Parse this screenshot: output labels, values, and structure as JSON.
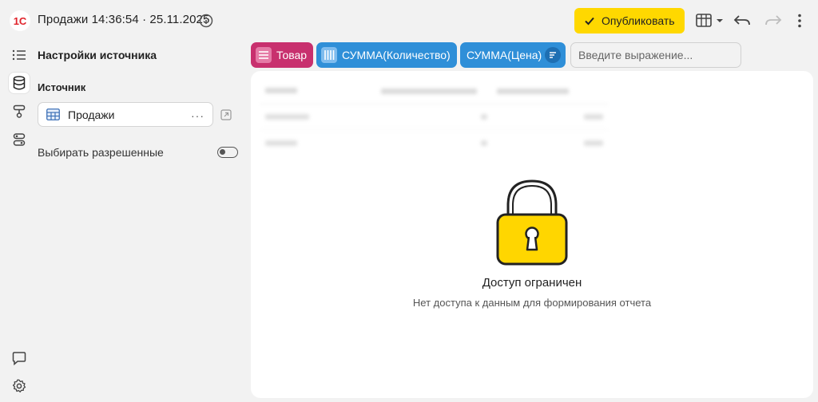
{
  "header": {
    "logo_text": "1С",
    "title": "Продажи 14:36:54 · 25.11.2025",
    "publish_label": "Опубликовать"
  },
  "sidebar": {
    "rail_items": [
      {
        "icon": "list-icon"
      },
      {
        "icon": "database-icon",
        "active": true
      },
      {
        "icon": "filter-icon"
      },
      {
        "icon": "parameters-icon"
      }
    ],
    "bottom_items": [
      {
        "icon": "chat-icon"
      },
      {
        "icon": "gear-icon"
      }
    ]
  },
  "settings": {
    "title": "Настройки источника",
    "source_label": "Источник",
    "source_name": "Продажи",
    "allowed_label": "Выбирать разрешенные",
    "allowed_enabled": false
  },
  "fields": {
    "chips": [
      {
        "label": "Товар",
        "color": "#c8306e"
      },
      {
        "label": "СУММА(Количество)",
        "color": "#2f8fd8"
      },
      {
        "label": "СУММА(Цена)",
        "color": "#2f8fd8"
      }
    ],
    "expression_placeholder": "Введите выражение..."
  },
  "main": {
    "access_title": "Доступ ограничен",
    "access_subtitle": "Нет доступа к данным для формирования отчета"
  },
  "colors": {
    "accent_yellow": "#ffd800",
    "chip_magenta": "#c8306e",
    "chip_blue": "#2f8fd8",
    "lock_yellow": "#ffd600"
  }
}
